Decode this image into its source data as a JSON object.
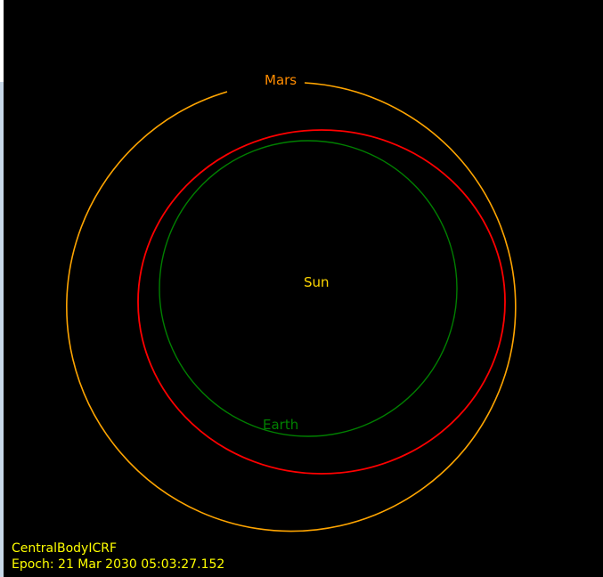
{
  "scene": {
    "background_color": "#000000",
    "frame_name": "CentralBodyICRF",
    "epoch_label": "Epoch: 21 Mar 2030 05:03:27.152",
    "status_color": "#ffff00"
  },
  "bodies": {
    "sun": {
      "label": "Sun",
      "color": "#ffd700"
    },
    "earth": {
      "label": "Earth",
      "color": "#008000",
      "orbit_color": "#008000"
    },
    "mars": {
      "label": "Mars",
      "color": "#ff8c00",
      "orbit_color": "#ffa500"
    },
    "transfer": {
      "orbit_color": "#ff0000"
    }
  }
}
